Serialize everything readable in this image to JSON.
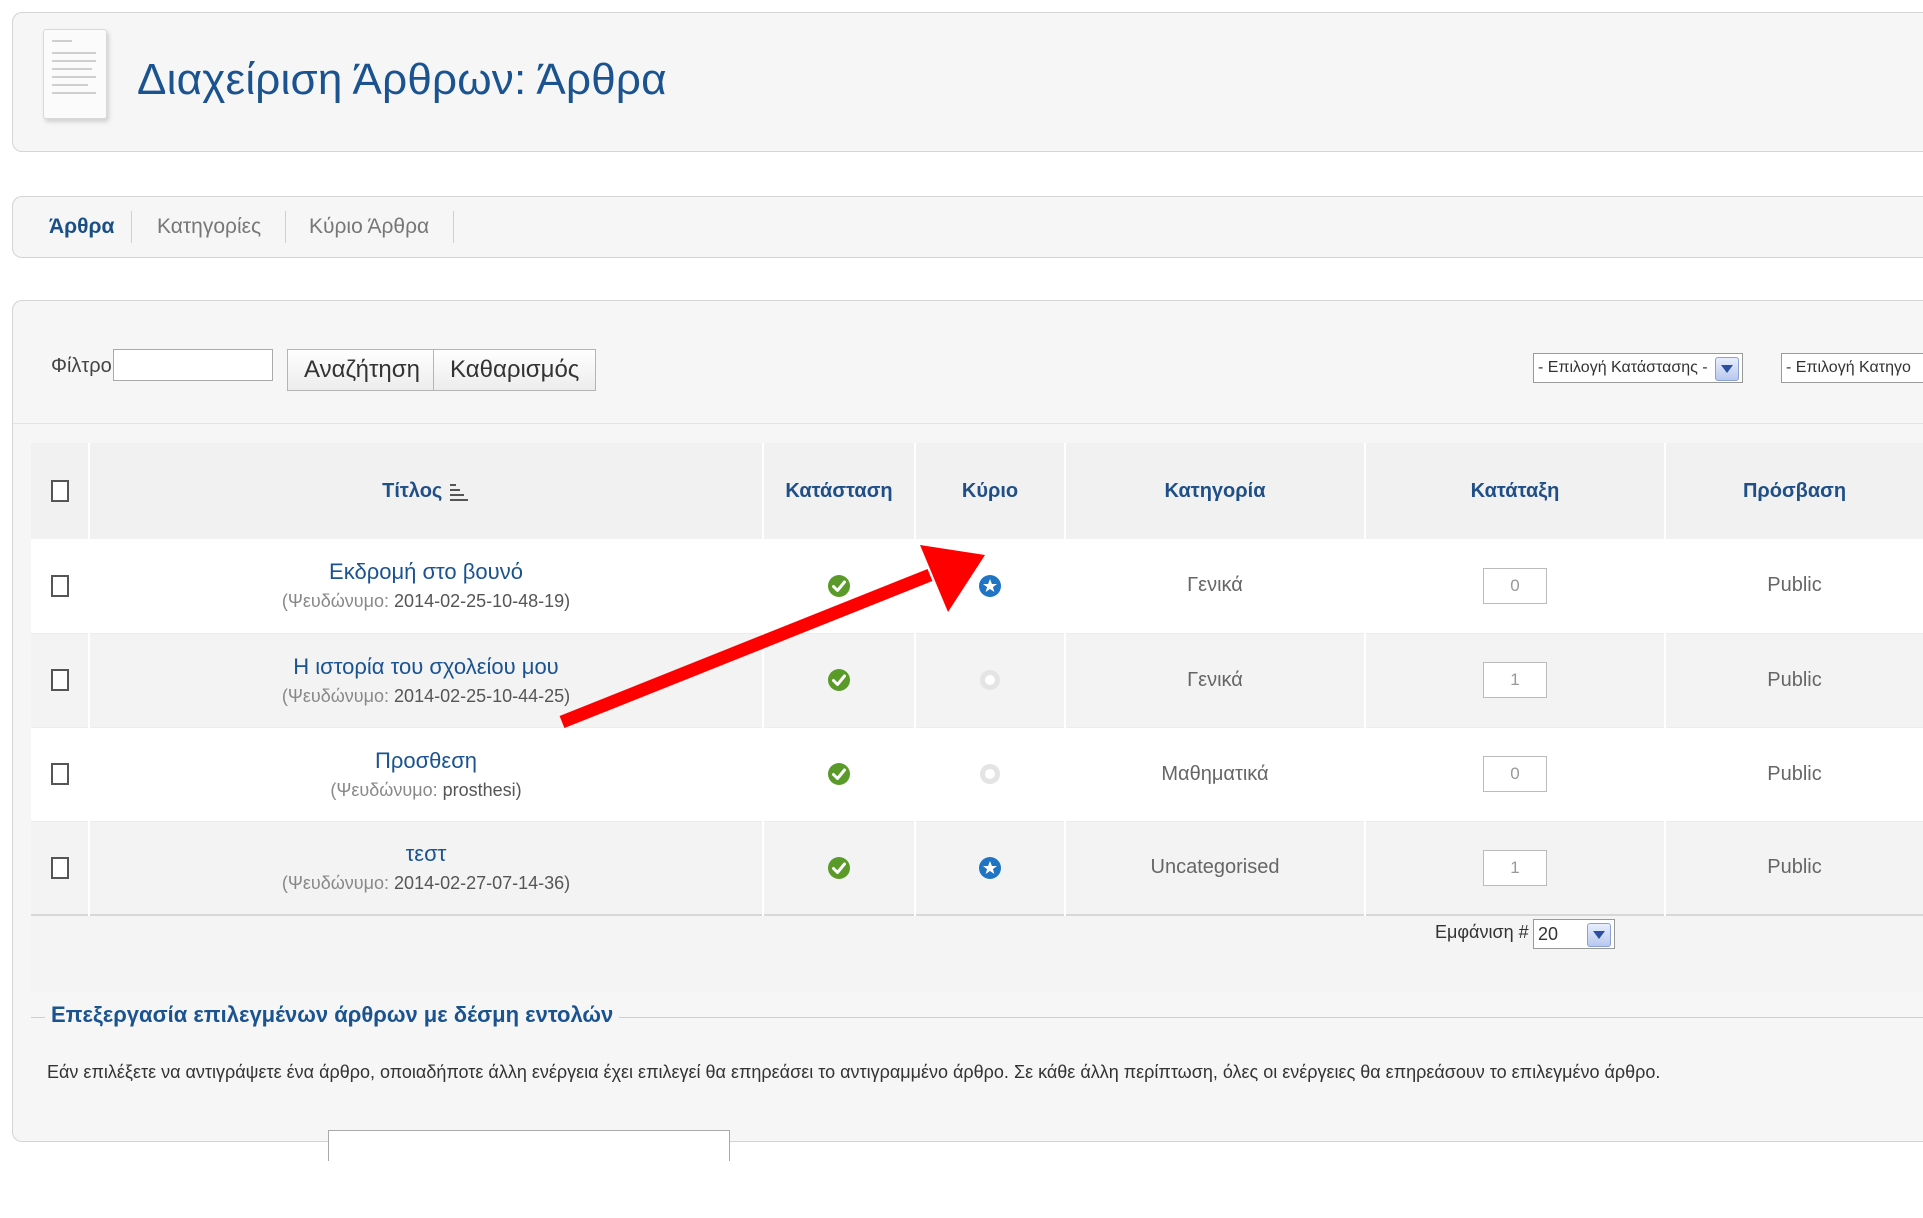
{
  "header": {
    "title": "Διαχείριση Άρθρων: Άρθρα",
    "icon": "document-icon"
  },
  "tabs": [
    {
      "label": "Άρθρα",
      "active": true
    },
    {
      "label": "Κατηγορίες",
      "active": false
    },
    {
      "label": "Κύριο Άρθρα",
      "active": false
    }
  ],
  "filter": {
    "label": "Φίλτρο:",
    "value": "",
    "search_button": "Αναζήτηση",
    "clear_button": "Καθαρισμός",
    "status_select": "- Επιλογή Κατάστασης -",
    "category_select": "- Επιλογή Κατηγο"
  },
  "table": {
    "columns": [
      "Τίτλος",
      "Κατάσταση",
      "Κύριο",
      "Κατηγορία",
      "Κατάταξη",
      "Πρόσβαση"
    ],
    "alias_label": "(Ψευδώνυμο:",
    "rows": [
      {
        "title": "Εκδρομή στο βουνό",
        "alias": "2014-02-25-10-48-19)",
        "published": true,
        "featured": true,
        "category": "Γενικά",
        "ordering": "0",
        "access": "Public"
      },
      {
        "title": "Η ιστορία του σχολείου μου",
        "alias": "2014-02-25-10-44-25)",
        "published": true,
        "featured": false,
        "category": "Γενικά",
        "ordering": "1",
        "access": "Public"
      },
      {
        "title": "Προσθεση",
        "alias": "prosthesi)",
        "published": true,
        "featured": false,
        "category": "Μαθηματικά",
        "ordering": "0",
        "access": "Public"
      },
      {
        "title": "τεστ",
        "alias": "2014-02-27-07-14-36)",
        "published": true,
        "featured": true,
        "category": "Uncategorised",
        "ordering": "1",
        "access": "Public"
      }
    ]
  },
  "pagination": {
    "display_label": "Εμφάνιση #",
    "display_value": "20"
  },
  "batch": {
    "legend": "Επεξεργασία επιλεγμένων άρθρων με δέσμη εντολών",
    "description": "Εάν επιλέξετε να αντιγράψετε ένα άρθρο, οποιαδήποτε άλλη ενέργεια έχει επιλεγεί θα επηρεάσει το αντιγραμμένο άρθρο. Σε κάθε άλλη περίπτωση, όλες οι ενέργειες θα επηρεάσουν το επιλεγμένο άρθρο."
  },
  "colors": {
    "link": "#1a5390",
    "published": "#5a9a28",
    "featured": "#1f74c4",
    "annotation_arrow": "#ff0000"
  }
}
